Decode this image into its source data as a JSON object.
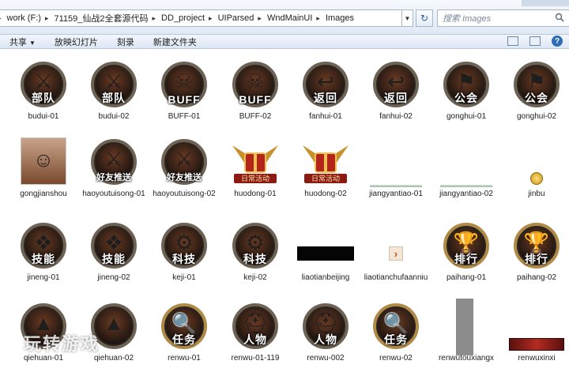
{
  "address": {
    "crumbs": [
      "work (F:)",
      "71159_仙战2全套源代码",
      "DD_project",
      "UIParsed",
      "WndMainUI",
      "Images"
    ],
    "search_placeholder": "搜索 Images"
  },
  "toolbar": {
    "share": "共享",
    "slideshow": "放映幻灯片",
    "burn": "刻录",
    "new_folder": "新建文件夹"
  },
  "files": [
    {
      "name": "budui-01",
      "label": "部队",
      "kind": "badge",
      "emblem": "⚔"
    },
    {
      "name": "budui-02",
      "label": "部队",
      "kind": "badge",
      "emblem": "⚔"
    },
    {
      "name": "BUFF-01",
      "label": "BUFF",
      "kind": "badge",
      "emblem": "☠"
    },
    {
      "name": "BUFF-02",
      "label": "BUFF",
      "kind": "badge",
      "emblem": "☠"
    },
    {
      "name": "fanhui-01",
      "label": "返回",
      "kind": "badge",
      "emblem": "↩"
    },
    {
      "name": "fanhui-02",
      "label": "返回",
      "kind": "badge",
      "emblem": "↩"
    },
    {
      "name": "gonghui-01",
      "label": "公会",
      "kind": "badge",
      "emblem": "⚑"
    },
    {
      "name": "gonghui-02",
      "label": "公会",
      "kind": "badge",
      "emblem": "⚑"
    },
    {
      "name": "gongjianshou",
      "label": "",
      "kind": "portrait",
      "emblem": "☺"
    },
    {
      "name": "haoyoutuisong-01",
      "label": "好友推送",
      "kind": "badge",
      "emblem": "⚔"
    },
    {
      "name": "haoyoutuisong-02",
      "label": "好友推送",
      "kind": "badge",
      "emblem": "⚔"
    },
    {
      "name": "huodong-01",
      "label": "日常活动",
      "kind": "wings",
      "emblem": "🎁"
    },
    {
      "name": "huodong-02",
      "label": "日常活动",
      "kind": "wings",
      "emblem": "🎁"
    },
    {
      "name": "jiangyantiao-01",
      "label": "",
      "kind": "line",
      "emblem": ""
    },
    {
      "name": "jiangyantiao-02",
      "label": "",
      "kind": "line",
      "emblem": ""
    },
    {
      "name": "jinbu",
      "label": "",
      "kind": "coin",
      "emblem": ""
    },
    {
      "name": "jineng-01",
      "label": "技能",
      "kind": "badge",
      "emblem": "❖"
    },
    {
      "name": "jineng-02",
      "label": "技能",
      "kind": "badge",
      "emblem": "❖"
    },
    {
      "name": "keji-01",
      "label": "科技",
      "kind": "badge",
      "emblem": "⚙"
    },
    {
      "name": "keji-02",
      "label": "科技",
      "kind": "badge",
      "emblem": "⚙"
    },
    {
      "name": "liaotianbeijing",
      "label": "",
      "kind": "blackbar",
      "emblem": ""
    },
    {
      "name": "liaotianchufaanniu",
      "label": "",
      "kind": "chevron",
      "emblem": "›"
    },
    {
      "name": "paihang-01",
      "label": "排行",
      "kind": "badge",
      "emblem": "🏆"
    },
    {
      "name": "paihang-02",
      "label": "排行",
      "kind": "badge",
      "emblem": "🏆"
    },
    {
      "name": "qiehuan-01",
      "label": "",
      "kind": "badge",
      "emblem": "▲"
    },
    {
      "name": "qiehuan-02",
      "label": "",
      "kind": "badge",
      "emblem": "▲"
    },
    {
      "name": "renwu-01",
      "label": "任务",
      "kind": "badge",
      "emblem": "🔍"
    },
    {
      "name": "renwu-01-119",
      "label": "人物",
      "kind": "badge",
      "emblem": "⛑"
    },
    {
      "name": "renwu-002",
      "label": "人物",
      "kind": "badge",
      "emblem": "⛑"
    },
    {
      "name": "renwu-02",
      "label": "任务",
      "kind": "badge",
      "emblem": "🔍"
    },
    {
      "name": "renwutouxiangx",
      "label": "",
      "kind": "graybar",
      "emblem": ""
    },
    {
      "name": "renwuxinxi",
      "label": "",
      "kind": "redstrip",
      "emblem": ""
    }
  ],
  "watermark": "玩转游戏"
}
